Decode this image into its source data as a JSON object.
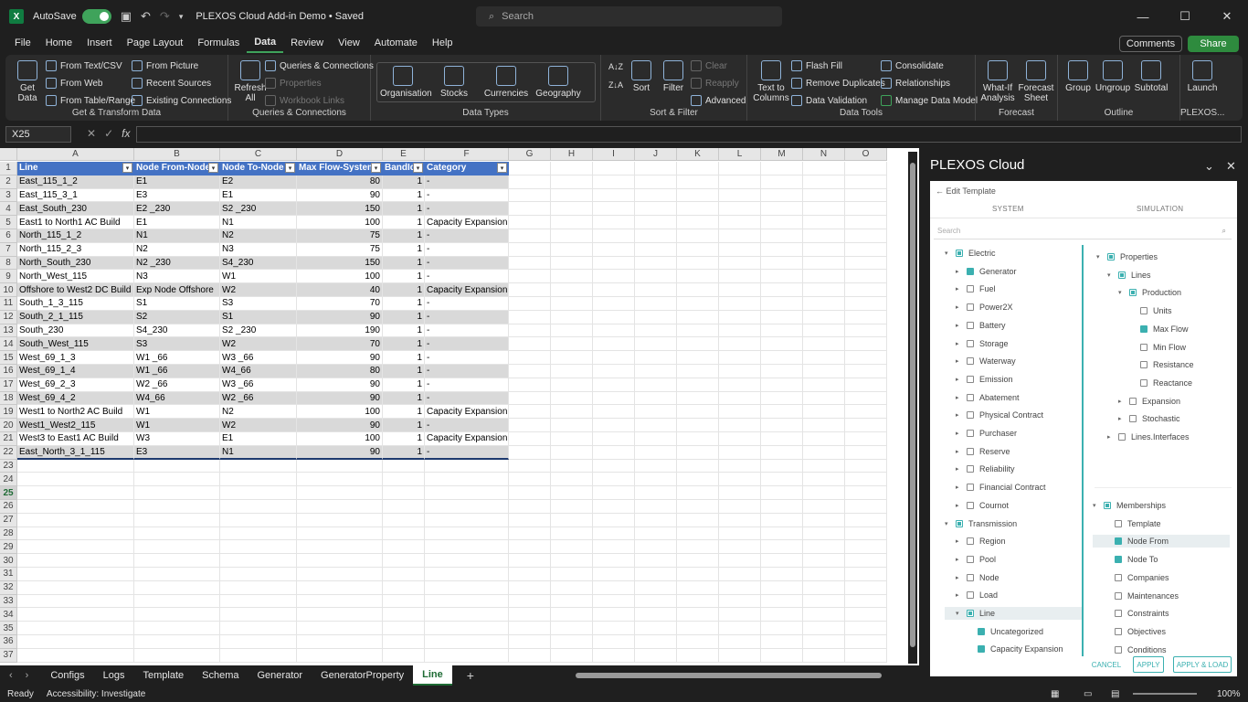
{
  "title": {
    "autosave": "AutoSave",
    "doc": "PLEXOS Cloud Add-in Demo • Saved"
  },
  "search": {
    "placeholder": "Search"
  },
  "menu": [
    "File",
    "Home",
    "Insert",
    "Page Layout",
    "Formulas",
    "Data",
    "Review",
    "View",
    "Automate",
    "Help"
  ],
  "buttons": {
    "comments": "Comments",
    "share": "Share"
  },
  "ribbon": {
    "get_data": "Get Data",
    "from_text": "From Text/CSV",
    "from_web": "From Web",
    "from_table": "From Table/Range",
    "from_picture": "From Picture",
    "recent": "Recent Sources",
    "existing": "Existing Connections",
    "g1": "Get & Transform Data",
    "refresh": "Refresh All",
    "queries": "Queries & Connections",
    "properties": "Properties",
    "workbook_links": "Workbook Links",
    "g2": "Queries & Connections",
    "dt": [
      "Organisation",
      "Stocks",
      "Currencies",
      "Geography"
    ],
    "g3": "Data Types",
    "sort": "Sort",
    "filter": "Filter",
    "clear": "Clear",
    "reapply": "Reapply",
    "advanced": "Advanced",
    "g4": "Sort & Filter",
    "t2c": "Text to Columns",
    "flash": "Flash Fill",
    "remdup": "Remove Duplicates",
    "dataval": "Data Validation",
    "consolidate": "Consolidate",
    "relationships": "Relationships",
    "manage": "Manage Data Model",
    "g5": "Data Tools",
    "whatif": "What-If Analysis",
    "forecast": "Forecast Sheet",
    "g6": "Forecast",
    "group": "Group",
    "ungroup": "Ungroup",
    "subtotal": "Subtotal",
    "g7": "Outline",
    "launch": "Launch",
    "g8": "PLEXOS..."
  },
  "namebox": "X25",
  "columns": [
    "A",
    "B",
    "C",
    "D",
    "E",
    "F",
    "G",
    "H",
    "I",
    "J",
    "K",
    "L",
    "M",
    "N",
    "O"
  ],
  "table": {
    "headers": [
      "Line",
      "Node From-Node",
      "Node To-Node",
      "Max Flow-System",
      "BandId",
      "Category"
    ],
    "rows": [
      [
        "East_115_1_2",
        "E1",
        "E2",
        "80",
        "1",
        "-"
      ],
      [
        "East_115_3_1",
        "E3",
        "E1",
        "90",
        "1",
        "-"
      ],
      [
        "East_South_230",
        "E2 _230",
        "S2 _230",
        "150",
        "1",
        "-"
      ],
      [
        "East1 to North1 AC Build",
        "E1",
        "N1",
        "100",
        "1",
        "Capacity Expansion"
      ],
      [
        "North_115_1_2",
        "N1",
        "N2",
        "75",
        "1",
        "-"
      ],
      [
        "North_115_2_3",
        "N2",
        "N3",
        "75",
        "1",
        "-"
      ],
      [
        "North_South_230",
        "N2 _230",
        "S4_230",
        "150",
        "1",
        "-"
      ],
      [
        "North_West_115",
        "N3",
        "W1",
        "100",
        "1",
        "-"
      ],
      [
        "Offshore to West2 DC Build",
        "Exp Node Offshore",
        "W2",
        "40",
        "1",
        "Capacity Expansion"
      ],
      [
        "South_1_3_115",
        "S1",
        "S3",
        "70",
        "1",
        "-"
      ],
      [
        "South_2_1_115",
        "S2",
        "S1",
        "90",
        "1",
        "-"
      ],
      [
        "South_230",
        "S4_230",
        "S2 _230",
        "190",
        "1",
        "-"
      ],
      [
        "South_West_115",
        "S3",
        "W2",
        "70",
        "1",
        "-"
      ],
      [
        "West_69_1_3",
        "W1 _66",
        "W3 _66",
        "90",
        "1",
        "-"
      ],
      [
        "West_69_1_4",
        "W1 _66",
        "W4_66",
        "80",
        "1",
        "-"
      ],
      [
        "West_69_2_3",
        "W2 _66",
        "W3 _66",
        "90",
        "1",
        "-"
      ],
      [
        "West_69_4_2",
        "W4_66",
        "W2 _66",
        "90",
        "1",
        "-"
      ],
      [
        "West1 to North2 AC Build",
        "W1",
        "N2",
        "100",
        "1",
        "Capacity Expansion"
      ],
      [
        "West1_West2_115",
        "W1",
        "W2",
        "90",
        "1",
        "-"
      ],
      [
        "West3 to East1 AC Build",
        "W3",
        "E1",
        "100",
        "1",
        "Capacity Expansion"
      ],
      [
        "East_North_3_1_115",
        "E3",
        "N1",
        "90",
        "1",
        "-"
      ]
    ]
  },
  "sheets": [
    "Configs",
    "Logs",
    "Template",
    "Schema",
    "Generator",
    "GeneratorProperty",
    "Line"
  ],
  "status": {
    "ready": "Ready",
    "access": "Accessibility: Investigate",
    "zoom": "100%"
  },
  "pane": {
    "title": "PLEXOS Cloud",
    "back": "Edit Template",
    "tab_system": "SYSTEM",
    "tab_sim": "SIMULATION",
    "search": "Search",
    "left": [
      {
        "t": "Electric",
        "lvl": 0,
        "arw": "▾",
        "cb": "part"
      },
      {
        "t": "Generator",
        "lvl": 1,
        "arw": "▸",
        "cb": "on"
      },
      {
        "t": "Fuel",
        "lvl": 1,
        "arw": "▸",
        "cb": ""
      },
      {
        "t": "Power2X",
        "lvl": 1,
        "arw": "▸",
        "cb": ""
      },
      {
        "t": "Battery",
        "lvl": 1,
        "arw": "▸",
        "cb": ""
      },
      {
        "t": "Storage",
        "lvl": 1,
        "arw": "▸",
        "cb": ""
      },
      {
        "t": "Waterway",
        "lvl": 1,
        "arw": "▸",
        "cb": ""
      },
      {
        "t": "Emission",
        "lvl": 1,
        "arw": "▸",
        "cb": ""
      },
      {
        "t": "Abatement",
        "lvl": 1,
        "arw": "▸",
        "cb": ""
      },
      {
        "t": "Physical Contract",
        "lvl": 1,
        "arw": "▸",
        "cb": ""
      },
      {
        "t": "Purchaser",
        "lvl": 1,
        "arw": "▸",
        "cb": ""
      },
      {
        "t": "Reserve",
        "lvl": 1,
        "arw": "▸",
        "cb": ""
      },
      {
        "t": "Reliability",
        "lvl": 1,
        "arw": "▸",
        "cb": ""
      },
      {
        "t": "Financial Contract",
        "lvl": 1,
        "arw": "▸",
        "cb": ""
      },
      {
        "t": "Cournot",
        "lvl": 1,
        "arw": "▸",
        "cb": ""
      },
      {
        "t": "Transmission",
        "lvl": 0,
        "arw": "▾",
        "cb": "part"
      },
      {
        "t": "Region",
        "lvl": 1,
        "arw": "▸",
        "cb": ""
      },
      {
        "t": "Pool",
        "lvl": 1,
        "arw": "▸",
        "cb": ""
      },
      {
        "t": "Node",
        "lvl": 1,
        "arw": "▸",
        "cb": ""
      },
      {
        "t": "Load",
        "lvl": 1,
        "arw": "▸",
        "cb": ""
      },
      {
        "t": "Line",
        "lvl": 1,
        "arw": "▾",
        "cb": "part",
        "hl": true
      },
      {
        "t": "Uncategorized",
        "lvl": 2,
        "arw": "",
        "cb": "on"
      },
      {
        "t": "Capacity Expansion",
        "lvl": 2,
        "arw": "",
        "cb": "on"
      }
    ],
    "right": [
      {
        "t": "Properties",
        "lvl": 0,
        "arw": "▾",
        "cb": "part"
      },
      {
        "t": "Lines",
        "lvl": 1,
        "arw": "▾",
        "cb": "part"
      },
      {
        "t": "Production",
        "lvl": 2,
        "arw": "▾",
        "cb": "part"
      },
      {
        "t": "Units",
        "lvl": 3,
        "arw": "",
        "cb": ""
      },
      {
        "t": "Max Flow",
        "lvl": 3,
        "arw": "",
        "cb": "on"
      },
      {
        "t": "Min Flow",
        "lvl": 3,
        "arw": "",
        "cb": ""
      },
      {
        "t": "Resistance",
        "lvl": 3,
        "arw": "",
        "cb": ""
      },
      {
        "t": "Reactance",
        "lvl": 3,
        "arw": "",
        "cb": ""
      },
      {
        "t": "Expansion",
        "lvl": 2,
        "arw": "▸",
        "cb": ""
      },
      {
        "t": "Stochastic",
        "lvl": 2,
        "arw": "▸",
        "cb": ""
      },
      {
        "t": "Lines.Interfaces",
        "lvl": 1,
        "arw": "▸",
        "cb": ""
      }
    ],
    "members": [
      {
        "t": "Memberships",
        "lvl": 0,
        "arw": "▾",
        "cb": "part"
      },
      {
        "t": "Template",
        "lvl": 1,
        "arw": "",
        "cb": ""
      },
      {
        "t": "Node From",
        "lvl": 1,
        "arw": "",
        "cb": "on",
        "hl": true
      },
      {
        "t": "Node To",
        "lvl": 1,
        "arw": "",
        "cb": "on"
      },
      {
        "t": "Companies",
        "lvl": 1,
        "arw": "",
        "cb": ""
      },
      {
        "t": "Maintenances",
        "lvl": 1,
        "arw": "",
        "cb": ""
      },
      {
        "t": "Constraints",
        "lvl": 1,
        "arw": "",
        "cb": ""
      },
      {
        "t": "Objectives",
        "lvl": 1,
        "arw": "",
        "cb": ""
      },
      {
        "t": "Conditions",
        "lvl": 1,
        "arw": "",
        "cb": ""
      }
    ],
    "cancel": "CANCEL",
    "apply": "APPLY",
    "apply_load": "APPLY & LOAD"
  }
}
